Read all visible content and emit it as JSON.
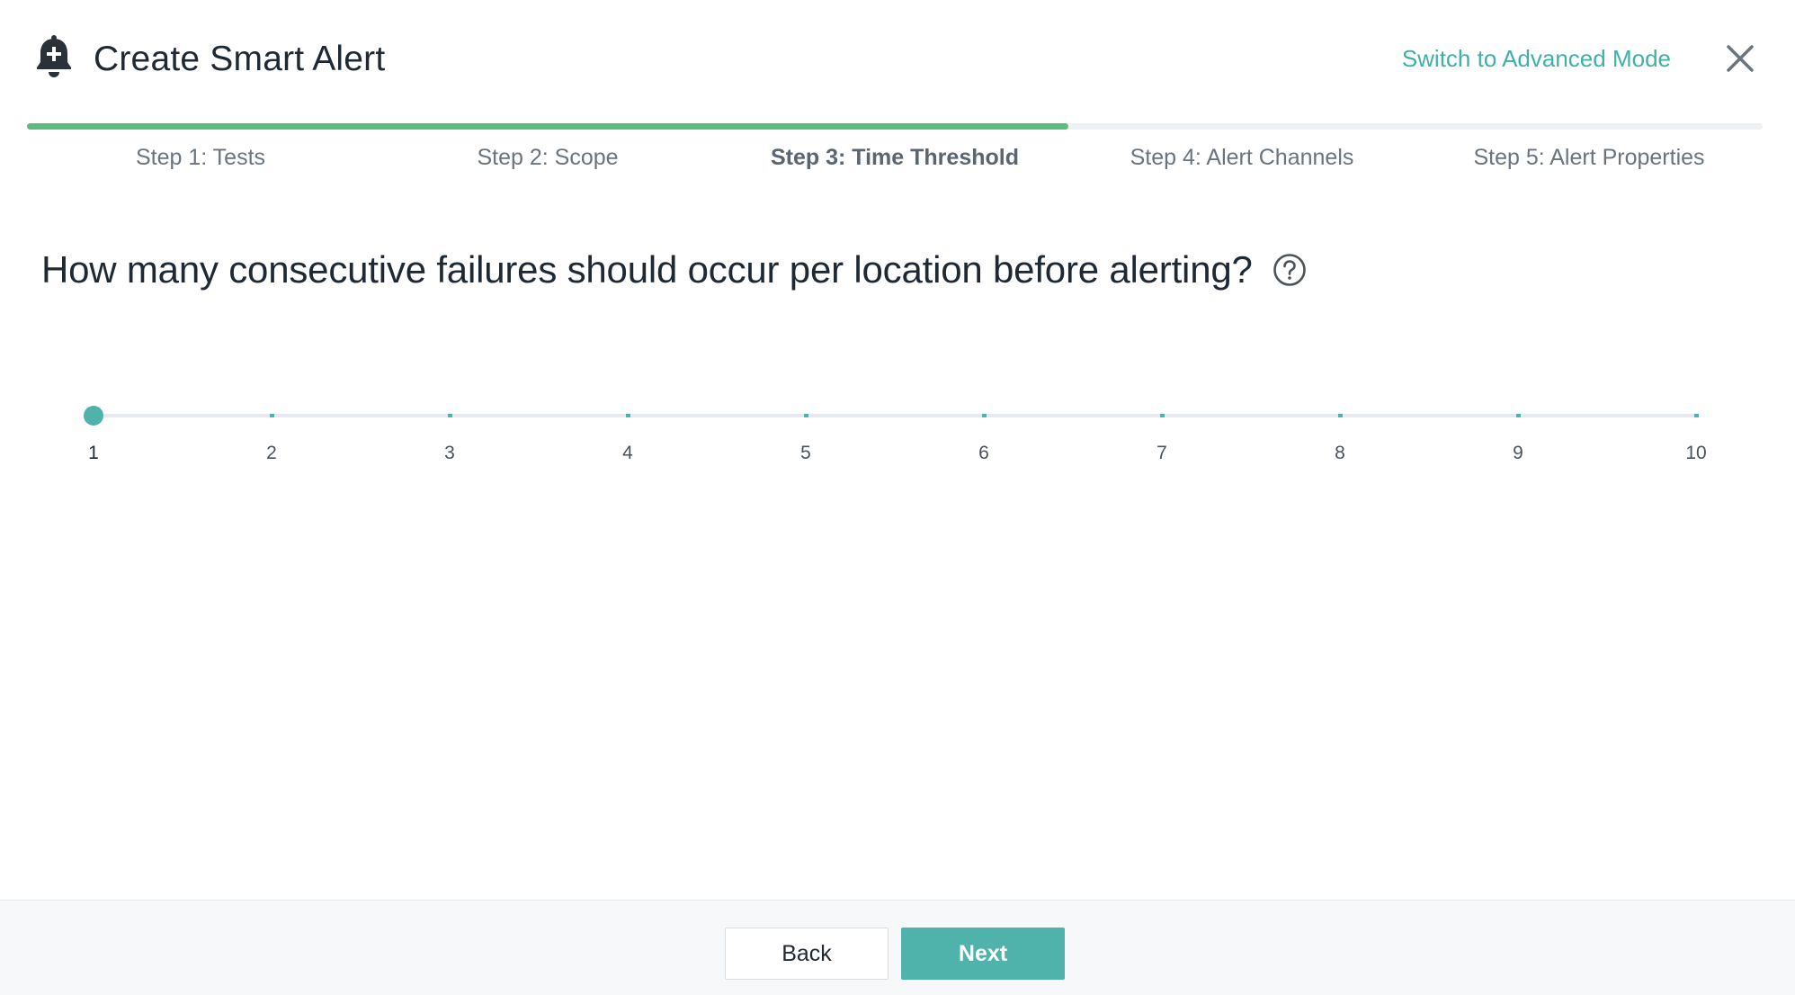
{
  "header": {
    "title": "Create Smart Alert",
    "icon": "bell-plus-icon",
    "advanced_mode_link": "Switch to Advanced Mode",
    "close_icon": "close-icon"
  },
  "wizard": {
    "progress_fraction": 0.6,
    "progress_color": "#5cbb7d",
    "current_step": 3,
    "steps": [
      {
        "label": "Step 1: Tests"
      },
      {
        "label": "Step 2: Scope"
      },
      {
        "label": "Step 3: Time Threshold"
      },
      {
        "label": "Step 4: Alert Channels"
      },
      {
        "label": "Step 5: Alert Properties"
      }
    ]
  },
  "question": {
    "text": "How many consecutive failures should occur per location before alerting?",
    "help_icon": "help-circle-icon"
  },
  "slider": {
    "min": 1,
    "max": 10,
    "value": 1,
    "labels": [
      "1",
      "2",
      "3",
      "4",
      "5",
      "6",
      "7",
      "8",
      "9",
      "10"
    ],
    "accent_color": "#4fb3ac"
  },
  "footer": {
    "back_label": "Back",
    "next_label": "Next"
  },
  "colors": {
    "accent": "#3eb1a8",
    "text": "#1f2933",
    "muted": "#6a747e"
  }
}
